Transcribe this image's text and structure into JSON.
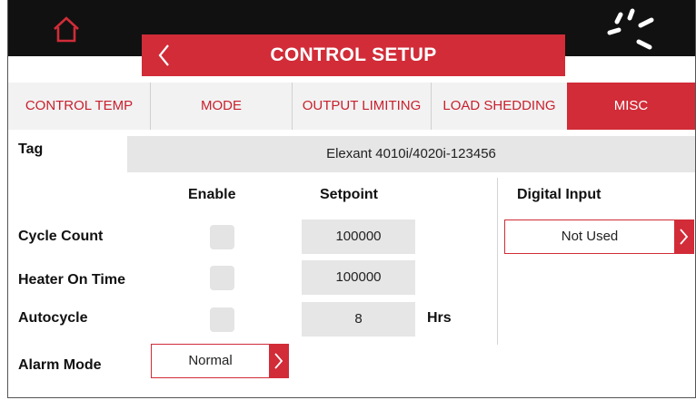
{
  "header": {
    "title": "CONTROL SETUP"
  },
  "tabs": [
    {
      "label": "CONTROL TEMP"
    },
    {
      "label": "MODE"
    },
    {
      "label": "OUTPUT LIMITING"
    },
    {
      "label": "LOAD SHEDDING"
    },
    {
      "label": "MISC",
      "active": true
    }
  ],
  "tag": {
    "label": "Tag",
    "value": "Elexant 4010i/4020i-123456"
  },
  "columns": {
    "enable": "Enable",
    "setpoint": "Setpoint"
  },
  "rows": [
    {
      "label": "Cycle Count",
      "enabled": false,
      "setpoint": "100000",
      "unit": ""
    },
    {
      "label": "Heater On Time",
      "enabled": false,
      "setpoint": "100000",
      "unit": ""
    },
    {
      "label": "Autocycle",
      "enabled": false,
      "setpoint": "8",
      "unit": "Hrs"
    }
  ],
  "alarm_mode": {
    "label": "Alarm Mode",
    "value": "Normal"
  },
  "digital_input": {
    "label": "Digital Input",
    "value": "Not Used"
  },
  "colors": {
    "accent": "#d12c38",
    "topbar": "#111111",
    "field_bg": "#e6e6e6"
  },
  "icons": [
    "home-icon",
    "back-chevron-icon",
    "spinner-icon",
    "chevron-right-icon"
  ]
}
